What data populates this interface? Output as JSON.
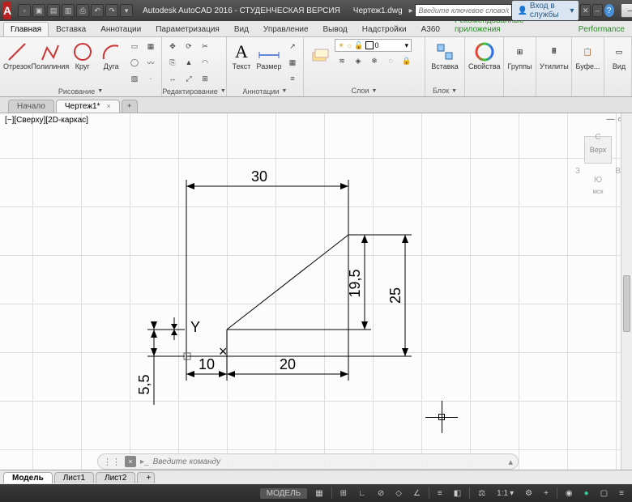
{
  "title": {
    "app": "Autodesk AutoCAD 2016 - СТУДЕНЧЕСКАЯ ВЕРСИЯ",
    "file": "Чертеж1.dwg",
    "search_ph": "Введите ключевое слово/фразу",
    "signin": "Вход в службы",
    "help": "?"
  },
  "ribbon_tabs": [
    "Главная",
    "Вставка",
    "Аннотации",
    "Параметризация",
    "Вид",
    "Управление",
    "Вывод",
    "Надстройки",
    "A360",
    "Рекомендованные приложения",
    "Performance"
  ],
  "ribbon_active": 0,
  "panels": {
    "draw": {
      "title": "Рисование",
      "btns": [
        "Отрезок",
        "Полилиния",
        "Круг",
        "Дуга"
      ]
    },
    "edit": {
      "title": "Редактирование"
    },
    "annot": {
      "title": "Аннотации",
      "btns": [
        "Текст",
        "Размер"
      ],
      "layers_btn": "Свойства\nслоя"
    },
    "layers": {
      "title": "Слои",
      "value": "0"
    },
    "block": {
      "title": "Блок",
      "btn": "Вставка"
    },
    "props": {
      "title": "Свойства"
    },
    "groups": {
      "title": "Группы"
    },
    "util": {
      "title": "Утилиты"
    },
    "clip": {
      "title": "Буфе..."
    },
    "view": {
      "title": "Вид"
    }
  },
  "file_tabs": [
    {
      "label": "Начало",
      "active": false
    },
    {
      "label": "Чертеж1*",
      "active": true
    }
  ],
  "view_label": "[−][Сверху][2D-каркас]",
  "viewcube": {
    "top": "Верх",
    "n": "С",
    "s": "Ю",
    "e": "В",
    "w": "З",
    "wcs": "мск"
  },
  "dimensions": {
    "d30": "30",
    "d10": "10",
    "d20": "20",
    "d55": "5,5",
    "d195": "19,5",
    "d25": "25"
  },
  "cmd": {
    "placeholder": "Введите команду"
  },
  "layout_tabs": [
    "Модель",
    "Лист1",
    "Лист2"
  ],
  "status": {
    "model": "МОДЕЛЬ",
    "scale": "1:1"
  }
}
